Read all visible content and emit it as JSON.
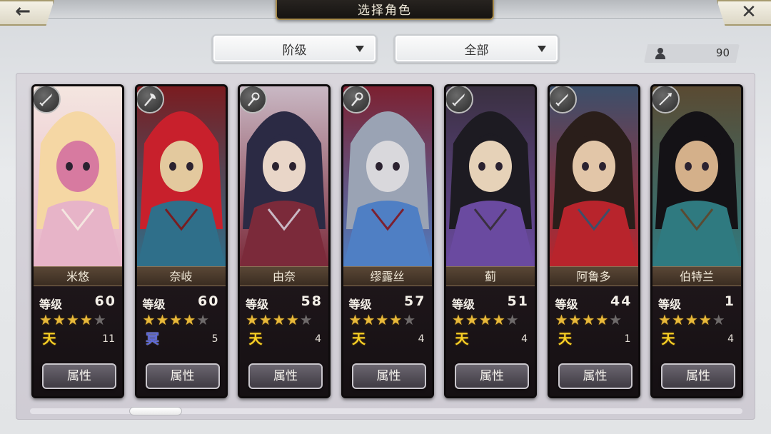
{
  "header": {
    "back_icon": "←",
    "title": "选择角色",
    "close_icon": "✕"
  },
  "filters": {
    "rank": {
      "label": "阶级"
    },
    "category": {
      "label": "全部"
    }
  },
  "roster_count": "90",
  "scrollbar": {
    "position": 0.15
  },
  "cards": [
    {
      "name": "米悠",
      "level_label": "等级",
      "level": "60",
      "stars": 4,
      "max_stars": 5,
      "rank_glyph": "天",
      "rank_style": "tian",
      "copies": "11",
      "attr_label": "属性",
      "weapon": "sword-icon",
      "palette": [
        "#f5d7a4",
        "#e7b4c8",
        "#d77aa0",
        "#f4e6e0"
      ]
    },
    {
      "name": "奈岐",
      "level_label": "等级",
      "level": "60",
      "stars": 4,
      "max_stars": 5,
      "rank_glyph": "冥",
      "rank_style": "ming",
      "copies": "5",
      "attr_label": "属性",
      "weapon": "axe-icon",
      "palette": [
        "#c8202c",
        "#2f6f8a",
        "#e3c99e",
        "#7a1c20"
      ]
    },
    {
      "name": "由奈",
      "level_label": "等级",
      "level": "58",
      "stars": 4,
      "max_stars": 5,
      "rank_glyph": "天",
      "rank_style": "tian",
      "copies": "4",
      "attr_label": "属性",
      "weapon": "staff-icon",
      "palette": [
        "#2b2a44",
        "#7b2a3a",
        "#e9d6c8",
        "#c9b8c4"
      ]
    },
    {
      "name": "缪露丝",
      "level_label": "等级",
      "level": "57",
      "stars": 4,
      "max_stars": 5,
      "rank_glyph": "天",
      "rank_style": "tian",
      "copies": "4",
      "attr_label": "属性",
      "weapon": "staff-icon",
      "palette": [
        "#9aa3b4",
        "#4f7fc4",
        "#d9d8dc",
        "#7c2030"
      ]
    },
    {
      "name": "蓟",
      "level_label": "等级",
      "level": "51",
      "stars": 4,
      "max_stars": 5,
      "rank_glyph": "天",
      "rank_style": "tian",
      "copies": "4",
      "attr_label": "属性",
      "weapon": "sword-icon",
      "palette": [
        "#1d1b22",
        "#6a4aa0",
        "#e6d2b8",
        "#3a3040"
      ]
    },
    {
      "name": "阿鲁多",
      "level_label": "等级",
      "level": "44",
      "stars": 4,
      "max_stars": 5,
      "rank_glyph": "天",
      "rank_style": "tian",
      "copies": "1",
      "attr_label": "属性",
      "weapon": "sword-icon",
      "palette": [
        "#2a1e1a",
        "#b8242c",
        "#e2c6a8",
        "#3c4f6a"
      ]
    },
    {
      "name": "伯特兰",
      "level_label": "等级",
      "level": "1",
      "stars": 4,
      "max_stars": 5,
      "rank_glyph": "天",
      "rank_style": "tian",
      "copies": "4",
      "attr_label": "属性",
      "weapon": "spear-icon",
      "palette": [
        "#141216",
        "#2f7a80",
        "#d4b08a",
        "#5a4a32"
      ]
    }
  ]
}
